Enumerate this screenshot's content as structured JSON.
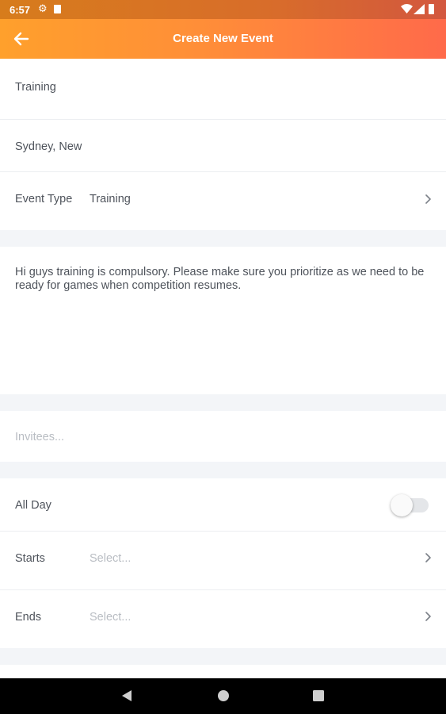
{
  "status_bar": {
    "time": "6:57"
  },
  "header": {
    "title": "Create New Event"
  },
  "form": {
    "title_value": "Training",
    "location_value": "Sydney, New",
    "event_type": {
      "label": "Event Type",
      "value": "Training"
    },
    "description": "Hi guys training is compulsory. Please make sure you prioritize as we need to be ready for games when competition resumes.",
    "invitees_placeholder": "Invitees...",
    "all_day": {
      "label": "All Day",
      "enabled": false
    },
    "starts": {
      "label": "Starts",
      "placeholder": "Select..."
    },
    "ends": {
      "label": "Ends",
      "placeholder": "Select..."
    }
  },
  "colors": {
    "header_gradient_start": "#ffa02c",
    "header_gradient_end": "#ff6a4a",
    "background": "#f3f5f8",
    "placeholder": "#b9bdc3"
  },
  "icons": [
    "back-arrow-icon",
    "chevron-right-icon",
    "settings-icon",
    "sim-card-icon",
    "wifi-icon",
    "signal-icon",
    "battery-icon",
    "nav-back-icon",
    "nav-home-icon",
    "nav-recents-icon"
  ]
}
